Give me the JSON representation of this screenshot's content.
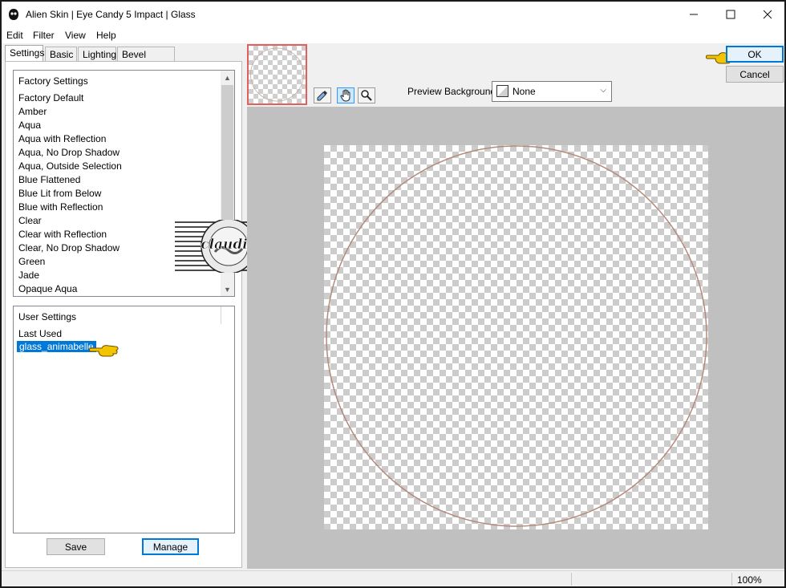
{
  "window": {
    "title": "Alien Skin | Eye Candy 5 Impact | Glass"
  },
  "menu": [
    "Edit",
    "Filter",
    "View",
    "Help"
  ],
  "tabs": [
    "Settings",
    "Basic",
    "Lighting",
    "Bevel Profile"
  ],
  "factory_settings": {
    "header": "Factory Settings",
    "items": [
      "Factory Default",
      "Amber",
      "Aqua",
      "Aqua with Reflection",
      "Aqua, No Drop Shadow",
      "Aqua, Outside Selection",
      "Blue Flattened",
      "Blue Lit from Below",
      "Blue with Reflection",
      "Clear",
      "Clear with Reflection",
      "Clear, No Drop Shadow",
      "Green",
      "Jade",
      "Opaque Aqua"
    ]
  },
  "user_settings": {
    "header": "User Settings",
    "items": [
      "Last Used",
      "glass_animabelle"
    ],
    "selected": "glass_animabelle"
  },
  "buttons": {
    "save": "Save",
    "manage": "Manage",
    "ok": "OK",
    "cancel": "Cancel"
  },
  "preview": {
    "background_label": "Preview Background:",
    "background_value": "None"
  },
  "status": {
    "zoom": "100%"
  },
  "watermark_text": "claudia",
  "colors": {
    "selection": "#0078d7",
    "thumb_border": "#e06060",
    "circle_stroke": "#b58a7c",
    "preview_bg": "#c0c0c0",
    "pointer_hand": "#f5c400"
  },
  "icons": [
    "app-icon",
    "minimize-icon",
    "maximize-icon",
    "close-icon",
    "scroll-up-icon",
    "scroll-down-icon",
    "eyedropper-icon",
    "hand-icon",
    "zoom-icon",
    "pointer-hand-icon",
    "dropdown-arrow-icon"
  ]
}
